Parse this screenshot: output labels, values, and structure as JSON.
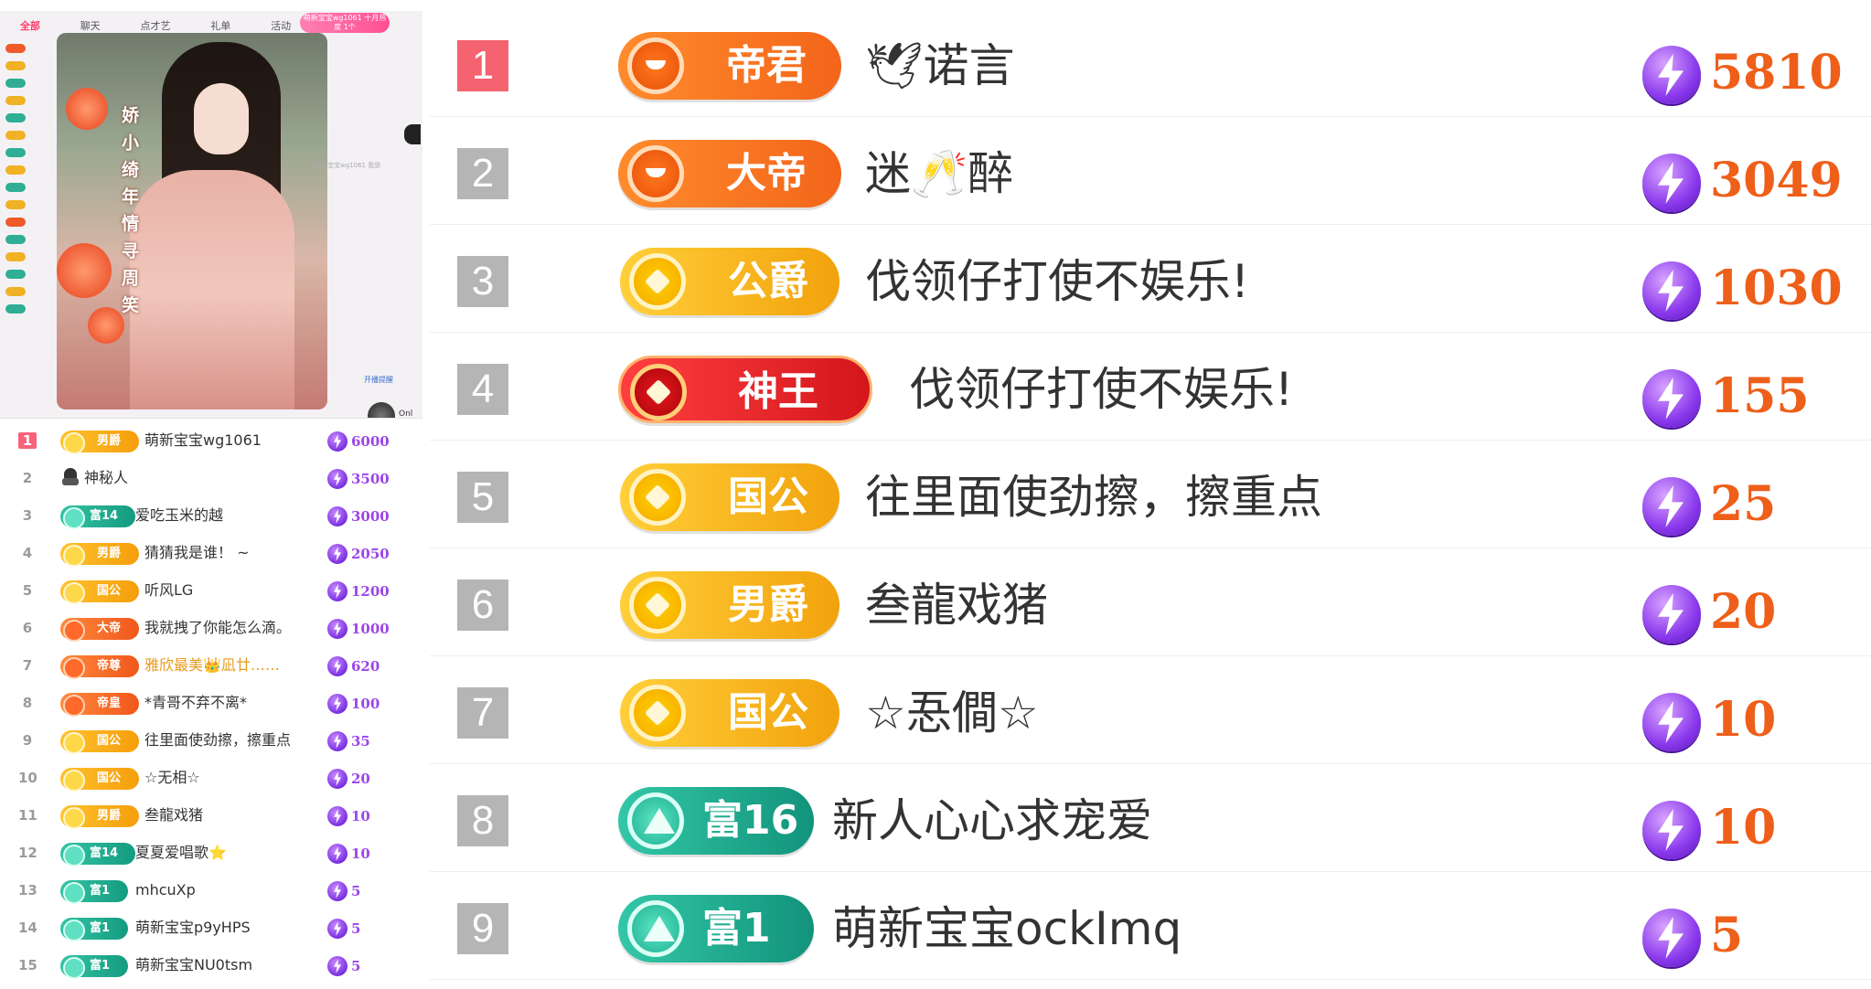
{
  "left_panel": {
    "tabs": [
      "全部",
      "聊天",
      "点才艺",
      "礼单",
      "活动"
    ],
    "pink_pill": "萌新宝宝wg1061 十月热度 1个",
    "calligraphy": "娇 小 绮 年 情 寻 周 笑",
    "open_tag": "开播提醒",
    "chat_snippet": "萌新宝宝wg1061 我是",
    "only_label": "Onl",
    "rows": [
      {
        "rank": "1",
        "badge": "男爵",
        "badge_style": "gold",
        "name": "萌新宝宝wg1061",
        "value": "6000"
      },
      {
        "rank": "2",
        "badge": "",
        "badge_style": "none",
        "name": "神秘人",
        "value": "3500"
      },
      {
        "rank": "3",
        "badge": "富14",
        "badge_style": "teal",
        "name": "爱吃玉米的越",
        "value": "3000"
      },
      {
        "rank": "4",
        "badge": "男爵",
        "badge_style": "gold",
        "name": "猜猜我是谁！ ~",
        "value": "2050"
      },
      {
        "rank": "5",
        "badge": "国公",
        "badge_style": "gold",
        "name": "听风LG",
        "value": "1200"
      },
      {
        "rank": "6",
        "badge": "大帝",
        "badge_style": "orange",
        "name": "我就拽了你能怎么滴。",
        "value": "1000"
      },
      {
        "rank": "7",
        "badge": "帝尊",
        "badge_style": "orange",
        "name": "雅欣最美👑凪廿……",
        "value": "620"
      },
      {
        "rank": "8",
        "badge": "帝皇",
        "badge_style": "orange",
        "name": "*青哥不弃不离*",
        "value": "100"
      },
      {
        "rank": "9",
        "badge": "国公",
        "badge_style": "gold",
        "name": "往里面使劲擦，擦重点",
        "value": "35"
      },
      {
        "rank": "10",
        "badge": "国公",
        "badge_style": "gold",
        "name": "☆无相☆",
        "value": "20"
      },
      {
        "rank": "11",
        "badge": "男爵",
        "badge_style": "gold",
        "name": "叁龍戏猪",
        "value": "10"
      },
      {
        "rank": "12",
        "badge": "富14",
        "badge_style": "teal",
        "name": "夏夏爱唱歌⭐",
        "value": "10"
      },
      {
        "rank": "13",
        "badge": "富1",
        "badge_style": "teal",
        "name": "mhcuXp",
        "value": "5"
      },
      {
        "rank": "14",
        "badge": "富1",
        "badge_style": "teal",
        "name": "萌新宝宝p9yHPS",
        "value": "5"
      },
      {
        "rank": "15",
        "badge": "富1",
        "badge_style": "teal",
        "name": "萌新宝宝NU0tsm",
        "value": "5"
      }
    ]
  },
  "right_panel": {
    "rows": [
      {
        "rank": "1",
        "badge": "帝君",
        "badge_style": "orange",
        "name": "🕊诺言",
        "value": "5810"
      },
      {
        "rank": "2",
        "badge": "大帝",
        "badge_style": "orange",
        "name": "迷🥂醉",
        "value": "3049"
      },
      {
        "rank": "3",
        "badge": "公爵",
        "badge_style": "gold",
        "name": "伐领仔打使不娱乐!",
        "value": "1030"
      },
      {
        "rank": "4",
        "badge": "神王",
        "badge_style": "red",
        "name": "伐领仔打使不娱乐!",
        "value": "155"
      },
      {
        "rank": "5",
        "badge": "国公",
        "badge_style": "gold",
        "name": "往里面使劲擦，擦重点",
        "value": "25"
      },
      {
        "rank": "6",
        "badge": "男爵",
        "badge_style": "gold",
        "name": "叁龍戏猪",
        "value": "20"
      },
      {
        "rank": "7",
        "badge": "国公",
        "badge_style": "gold",
        "name": "☆忢僴☆",
        "value": "10"
      },
      {
        "rank": "8",
        "badge": "富16",
        "badge_style": "teal",
        "name": "新人心心求宠爱",
        "value": "10"
      },
      {
        "rank": "9",
        "badge": "富1",
        "badge_style": "teal",
        "name": "萌新宝宝ockImq",
        "value": "5"
      }
    ]
  },
  "colors": {
    "rank_first": "#f4636f",
    "rank_default": "#b5b5b5",
    "gift_value_left": "#9b45ea",
    "gift_value_right": "#ee5f1a",
    "coin_purple": "#8a39ec"
  },
  "icons": {
    "coin": "lightning-coin-icon",
    "mystery": "mystery-user-icon"
  }
}
